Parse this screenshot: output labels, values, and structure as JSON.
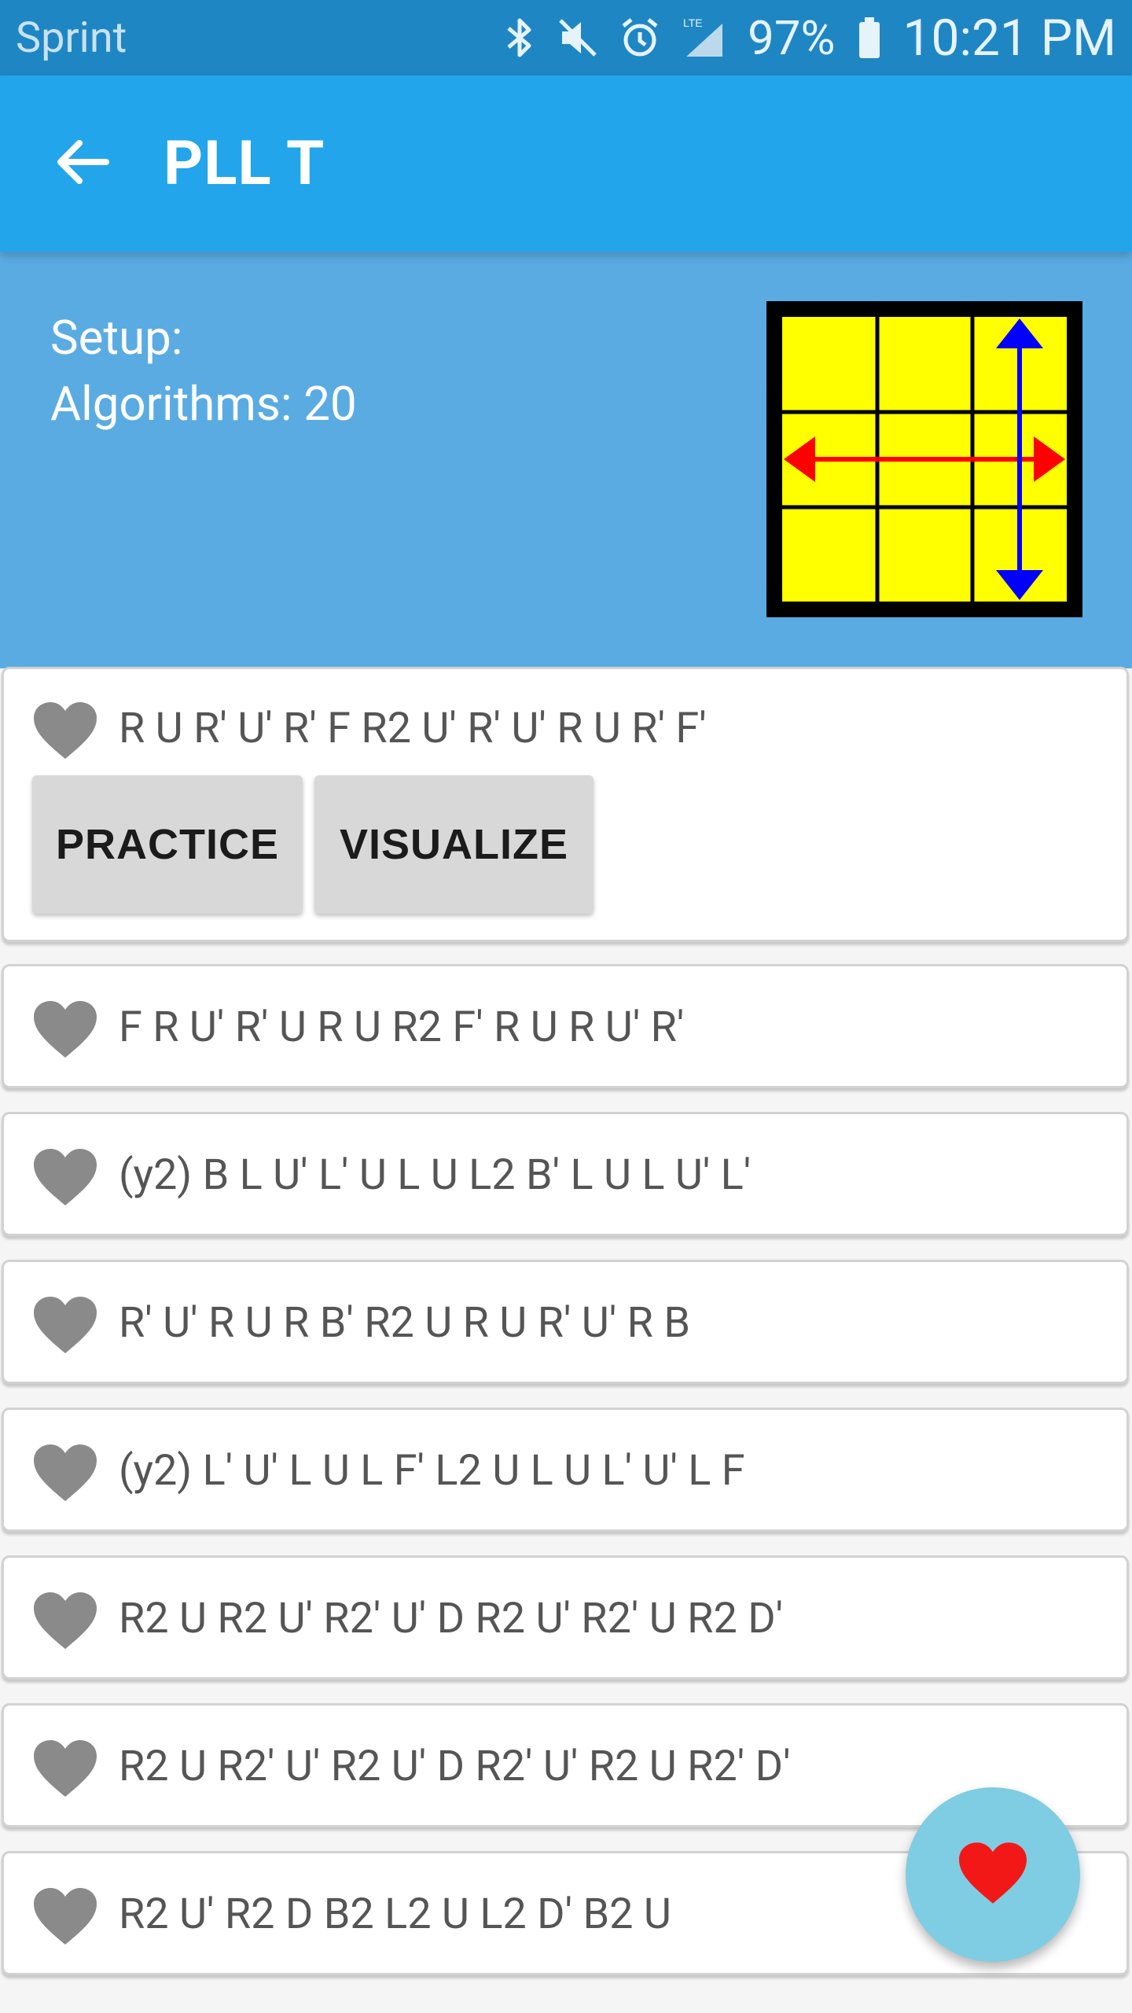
{
  "status_bar": {
    "carrier": "Sprint",
    "battery": "97%",
    "time": "10:21 PM",
    "icons": [
      "bluetooth-icon",
      "mute-icon",
      "alarm-icon",
      "lte-signal-icon",
      "battery-icon"
    ]
  },
  "app_bar": {
    "title": "PLL T",
    "back_icon": "arrow-left-icon"
  },
  "header": {
    "setup_label": "Setup:",
    "algorithms_label": "Algorithms: 20",
    "diagram_icon": "pll-t-cube-diagram"
  },
  "algorithms": [
    {
      "moves": "R U R' U' R' F R2 U' R' U' R U R' F'",
      "expanded": true
    },
    {
      "moves": "F R U' R' U R U R2 F' R U R U' R'"
    },
    {
      "moves": "(y2) B L U' L' U L U L2 B' L U L U' L'"
    },
    {
      "moves": "R' U' R U R B' R2 U R U R' U' R B"
    },
    {
      "moves": "(y2) L' U' L U L F' L2 U L U L' U' L F"
    },
    {
      "moves": "R2 U R2 U' R2' U' D R2 U' R2' U R2 D'"
    },
    {
      "moves": "R2 U R2' U' R2 U' D R2' U' R2 U R2' D'"
    },
    {
      "moves": "R2 U' R2 D B2 L2 U L2 D' B2 U"
    }
  ],
  "actions": {
    "practice": "PRACTICE",
    "visualize": "VISUALIZE"
  },
  "colors": {
    "status_bar": "#1f86c4",
    "app_bar": "#22a5ea",
    "header": "#5aabe2",
    "heart": "#8a8a8a",
    "fab": "#7fcde2",
    "fab_heart": "#f21818"
  }
}
